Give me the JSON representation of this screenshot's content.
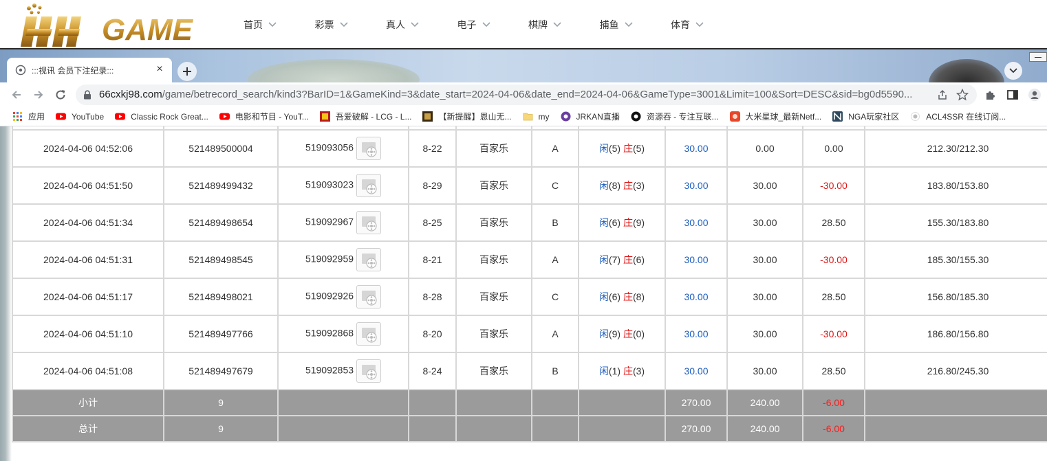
{
  "site": {
    "logo_text": "HH GAME",
    "nav": [
      {
        "label": "首页"
      },
      {
        "label": "彩票"
      },
      {
        "label": "真人"
      },
      {
        "label": "电子"
      },
      {
        "label": "棋牌"
      },
      {
        "label": "捕鱼"
      },
      {
        "label": "体育"
      }
    ]
  },
  "browser": {
    "tab_title": ":::视讯 会员下注纪录:::",
    "tab_close": "×",
    "url_host": "66cxkj98.com",
    "url_path": "/game/betrecord_search/kind3?BarID=1&GameKind=3&date_start=2024-04-06&date_end=2024-04-06&GameType=3001&Limit=100&Sort=DESC&sid=bg0d5590...",
    "bookmarks": [
      {
        "label": "应用",
        "icon": "apps-grid-icon"
      },
      {
        "label": "YouTube",
        "icon": "youtube-icon"
      },
      {
        "label": "Classic Rock Great...",
        "icon": "youtube-icon"
      },
      {
        "label": "电影和节目 - YouT...",
        "icon": "youtube-icon"
      },
      {
        "label": "吾爱破解 - LCG - L...",
        "icon": "site-icon"
      },
      {
        "label": "【新提醒】恩山无...",
        "icon": "site-icon"
      },
      {
        "label": "my",
        "icon": "folder-icon"
      },
      {
        "label": "JRKAN直播",
        "icon": "site-icon"
      },
      {
        "label": "资源吞 - 专注互联...",
        "icon": "site-icon"
      },
      {
        "label": "大米星球_最新Netf...",
        "icon": "site-icon"
      },
      {
        "label": "NGA玩家社区",
        "icon": "site-icon"
      },
      {
        "label": "ACL4SSR 在线订阅...",
        "icon": "site-icon"
      }
    ]
  },
  "colors": {
    "blue": "#1f5fbf",
    "red": "#e01515",
    "summary_bg": "#9b9b9b",
    "header_rule": "#2a2a2a"
  },
  "table": {
    "rows": [
      {
        "time": "2024-04-06 04:52:06",
        "bet_no": "521489500004",
        "round_no": "519093056",
        "table_no": "8-22",
        "game": "百家乐",
        "bet_on": "A",
        "player_label": "闲",
        "player_pts": "(5)",
        "banker_label": "庄",
        "banker_pts": "(5)",
        "bet": "30.00",
        "valid": "0.00",
        "win": "0.00",
        "win_neg": false,
        "balance": "212.30/212.30"
      },
      {
        "time": "2024-04-06 04:51:50",
        "bet_no": "521489499432",
        "round_no": "519093023",
        "table_no": "8-29",
        "game": "百家乐",
        "bet_on": "C",
        "player_label": "闲",
        "player_pts": "(8)",
        "banker_label": "庄",
        "banker_pts": "(3)",
        "bet": "30.00",
        "valid": "30.00",
        "win": "-30.00",
        "win_neg": true,
        "balance": "183.80/153.80"
      },
      {
        "time": "2024-04-06 04:51:34",
        "bet_no": "521489498654",
        "round_no": "519092967",
        "table_no": "8-25",
        "game": "百家乐",
        "bet_on": "B",
        "player_label": "闲",
        "player_pts": "(6)",
        "banker_label": "庄",
        "banker_pts": "(9)",
        "bet": "30.00",
        "valid": "30.00",
        "win": "28.50",
        "win_neg": false,
        "balance": "155.30/183.80"
      },
      {
        "time": "2024-04-06 04:51:31",
        "bet_no": "521489498545",
        "round_no": "519092959",
        "table_no": "8-21",
        "game": "百家乐",
        "bet_on": "A",
        "player_label": "闲",
        "player_pts": "(7)",
        "banker_label": "庄",
        "banker_pts": "(6)",
        "bet": "30.00",
        "valid": "30.00",
        "win": "-30.00",
        "win_neg": true,
        "balance": "185.30/155.30"
      },
      {
        "time": "2024-04-06 04:51:17",
        "bet_no": "521489498021",
        "round_no": "519092926",
        "table_no": "8-28",
        "game": "百家乐",
        "bet_on": "C",
        "player_label": "闲",
        "player_pts": "(6)",
        "banker_label": "庄",
        "banker_pts": "(8)",
        "bet": "30.00",
        "valid": "30.00",
        "win": "28.50",
        "win_neg": false,
        "balance": "156.80/185.30"
      },
      {
        "time": "2024-04-06 04:51:10",
        "bet_no": "521489497766",
        "round_no": "519092868",
        "table_no": "8-20",
        "game": "百家乐",
        "bet_on": "A",
        "player_label": "闲",
        "player_pts": "(9)",
        "banker_label": "庄",
        "banker_pts": "(0)",
        "bet": "30.00",
        "valid": "30.00",
        "win": "-30.00",
        "win_neg": true,
        "balance": "186.80/156.80"
      },
      {
        "time": "2024-04-06 04:51:08",
        "bet_no": "521489497679",
        "round_no": "519092853",
        "table_no": "8-24",
        "game": "百家乐",
        "bet_on": "B",
        "player_label": "闲",
        "player_pts": "(1)",
        "banker_label": "庄",
        "banker_pts": "(3)",
        "bet": "30.00",
        "valid": "30.00",
        "win": "28.50",
        "win_neg": false,
        "balance": "216.80/245.30"
      }
    ],
    "subtotal": {
      "label": "小计",
      "count": "9",
      "bet": "270.00",
      "valid": "240.00",
      "win": "-6.00"
    },
    "total": {
      "label": "总计",
      "count": "9",
      "bet": "270.00",
      "valid": "240.00",
      "win": "-6.00"
    }
  }
}
